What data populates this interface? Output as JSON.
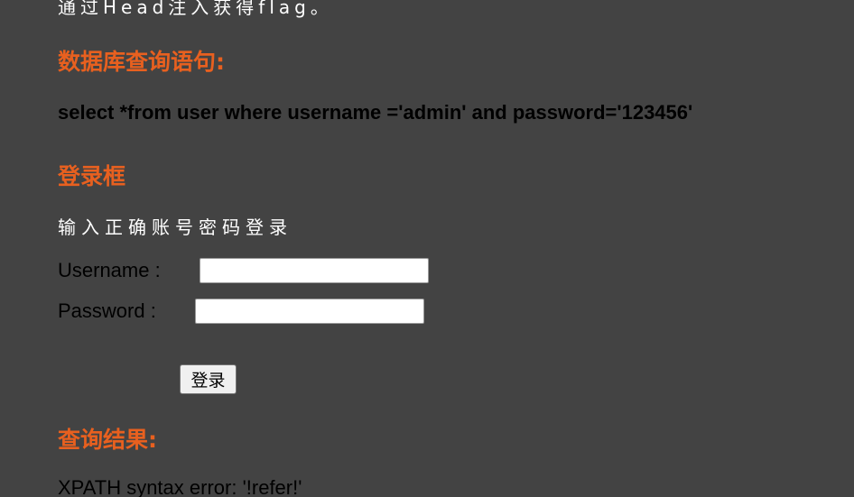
{
  "intro_text": "通过Head注入获得flag。",
  "sql_section": {
    "heading": "数据库查询语句:",
    "query": "select *from user where username ='admin' and password='123456'"
  },
  "login_section": {
    "heading": "登录框",
    "hint": "输入正确账号密码登录",
    "username_label": "Username :",
    "username_value": "",
    "password_label": "Password :",
    "password_value": "",
    "submit_label": "登录"
  },
  "result_section": {
    "heading": "查询结果:",
    "text": "XPATH syntax error: '!refer!'"
  },
  "colors": {
    "background": "#434343",
    "heading": "#e8601f",
    "body_text": "#000000",
    "light_text": "#ffffff"
  }
}
